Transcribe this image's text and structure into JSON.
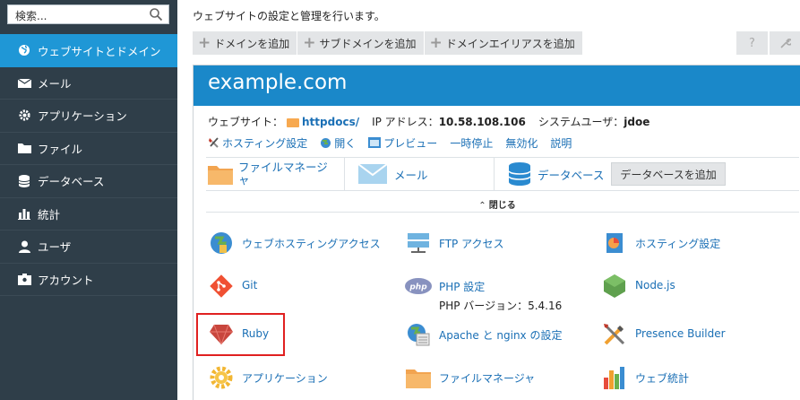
{
  "sidebar": {
    "search_placeholder": "検索...",
    "items": [
      {
        "label": "ウェブサイトとドメイン",
        "icon": "globe-icon",
        "active": true
      },
      {
        "label": "メール",
        "icon": "mail-icon"
      },
      {
        "label": "アプリケーション",
        "icon": "gear-icon"
      },
      {
        "label": "ファイル",
        "icon": "folder-icon"
      },
      {
        "label": "データベース",
        "icon": "database-icon"
      },
      {
        "label": "統計",
        "icon": "bar-chart-icon"
      },
      {
        "label": "ユーザ",
        "icon": "user-icon"
      },
      {
        "label": "アカウント",
        "icon": "account-icon"
      }
    ]
  },
  "header": {
    "description": "ウェブサイトの設定と管理を行います。"
  },
  "toolbar": {
    "add_domain": "ドメインを追加",
    "add_subdomain": "サブドメインを追加",
    "add_alias": "ドメインエイリアスを追加",
    "help": "?",
    "tools": "wrench-icon"
  },
  "domain": {
    "name": "example.com",
    "website_label": "ウェブサイト：",
    "website_link": "httpdocs/",
    "ip_label": "IP アドレス：",
    "ip": "10.58.108.106",
    "sysuser_label": "システムユーザ：",
    "sysuser": "jdoe",
    "actions": [
      "ホスティング設定",
      "開く",
      "プレビュー",
      "一時停止",
      "無効化",
      "説明"
    ]
  },
  "quick": {
    "file_manager": "ファイルマネージャ",
    "mail": "メール",
    "database": "データベース",
    "add_database": "データベースを追加"
  },
  "collapse_label": "閉じる",
  "tools": {
    "web_hosting_access": "ウェブホスティングアクセス",
    "ftp_access": "FTP アクセス",
    "hosting_settings": "ホスティング設定",
    "git": "Git",
    "php_settings": "PHP 設定",
    "php_version": "PHP バージョン：5.4.16",
    "nodejs": "Node.js",
    "ruby": "Ruby",
    "apache_nginx": "Apache と nginx の設定",
    "presence_builder": "Presence Builder",
    "applications": "アプリケーション",
    "file_manager": "ファイルマネージャ",
    "web_stats": "ウェブ統計"
  },
  "colors": {
    "sidebar": "#2f3e49",
    "active": "#1f97d6",
    "header": "#1a88c9",
    "link": "#1a6fb5",
    "highlight": "#e02020"
  }
}
